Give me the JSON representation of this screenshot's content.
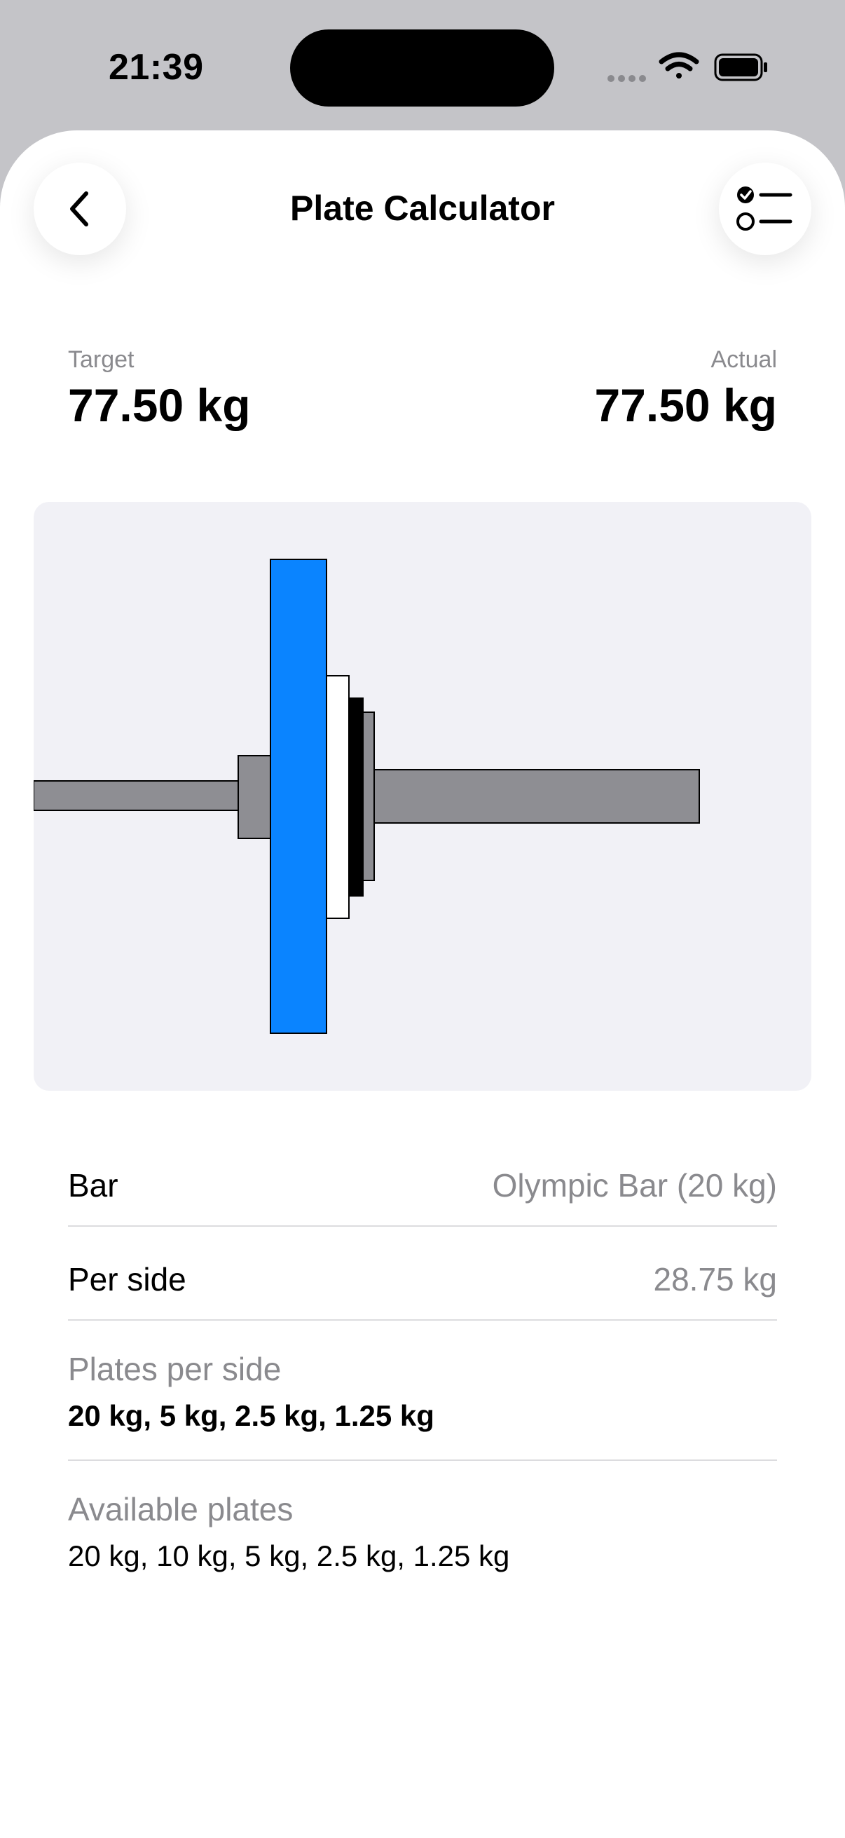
{
  "status_bar": {
    "time": "21:39"
  },
  "nav": {
    "title": "Plate Calculator"
  },
  "weights": {
    "target_label": "Target",
    "target_value": "77.50 kg",
    "actual_label": "Actual",
    "actual_value": "77.50 kg"
  },
  "details": {
    "bar_label": "Bar",
    "bar_value": "Olympic Bar (20 kg)",
    "per_side_label": "Per side",
    "per_side_value": "28.75 kg",
    "plates_per_side_label": "Plates per side",
    "plates_per_side_value": "20 kg, 5 kg, 2.5 kg, 1.25 kg",
    "available_plates_label": "Available plates",
    "available_plates_value": "20 kg, 10 kg, 5 kg, 2.5 kg, 1.25 kg"
  },
  "colors": {
    "plate_20kg": "#0a84ff",
    "plate_5kg": "#ffffff",
    "plate_2_5kg": "#000000",
    "plate_1_25kg": "#8e8e93",
    "bar": "#8e8e93"
  },
  "icons": {
    "back": "chevron-left-icon",
    "settings": "checklist-icon"
  }
}
